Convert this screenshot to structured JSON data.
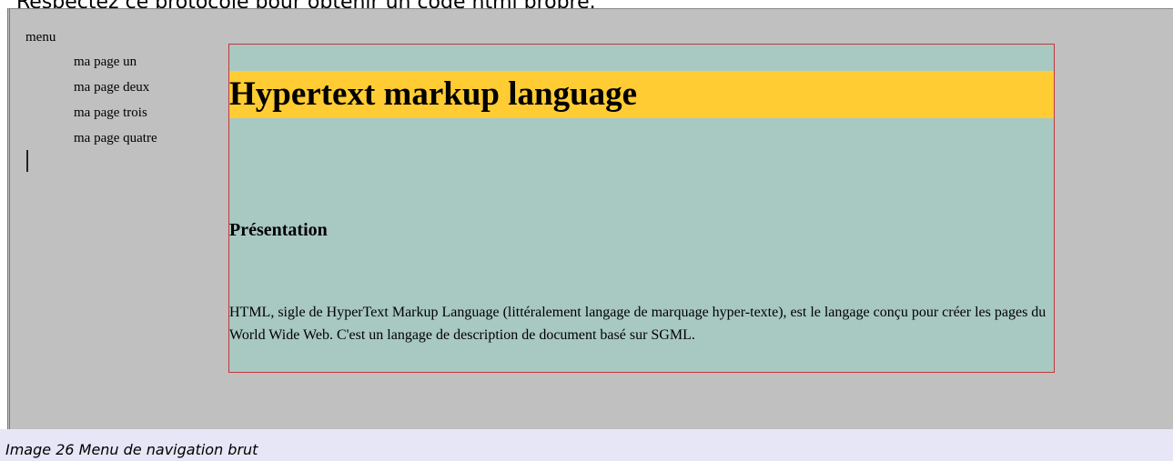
{
  "intro_text": "Respectez ce protocole pour obtenir un code html propre.",
  "menu": {
    "title": "menu",
    "items": [
      {
        "label": "ma page un"
      },
      {
        "label": "ma page deux"
      },
      {
        "label": "ma page trois"
      },
      {
        "label": "ma page quatre"
      }
    ]
  },
  "content": {
    "heading": "Hypertext markup language",
    "subheading": "Présentation",
    "paragraph": "HTML, sigle de HyperText Markup Language (littéralement langage de marquage hyper-texte), est le langage conçu pour créer les pages du World Wide Web. C'est un langage de description de document basé sur SGML."
  },
  "caption": "Image 26 Menu de navigation brut",
  "colors": {
    "page_background": "#c0c0c0",
    "content_background": "#a8c8c2",
    "content_border": "#c0393b",
    "banner_background": "#ffcc33",
    "caption_background": "#e6e6f6"
  }
}
